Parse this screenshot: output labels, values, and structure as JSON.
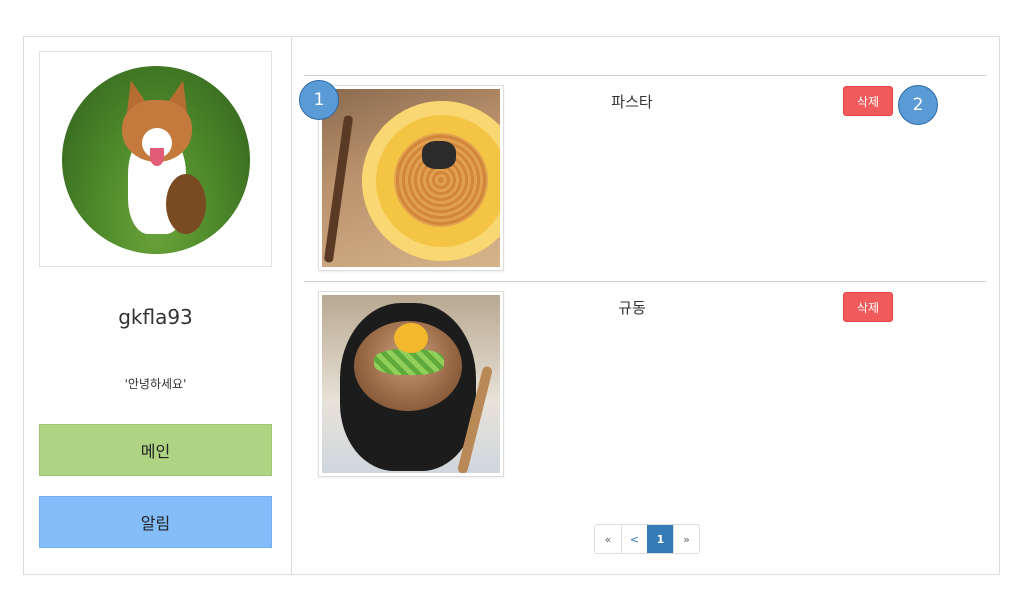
{
  "profile": {
    "username": "gkfla93",
    "greeting": "'안녕하세요'",
    "main_label": "메인",
    "alarm_label": "알림"
  },
  "items": [
    {
      "name": "파스타",
      "delete_label": "삭제"
    },
    {
      "name": "규동",
      "delete_label": "삭제"
    }
  ],
  "markers": [
    "1",
    "2"
  ],
  "pagination": {
    "first": "«",
    "prev": "<",
    "current": "1",
    "next": "»"
  },
  "colors": {
    "main_button": "#add383",
    "alarm_button": "#85bdf9",
    "delete_button": "#f05a5a",
    "page_active": "#337ab7",
    "marker": "#5b9bd5"
  }
}
